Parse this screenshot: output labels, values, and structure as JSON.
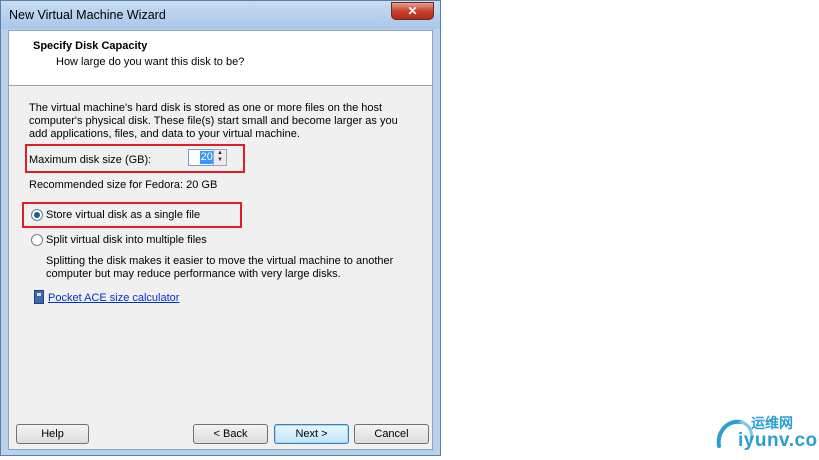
{
  "window": {
    "title": "New Virtual Machine Wizard",
    "close_glyph": "✕"
  },
  "header": {
    "title": "Specify Disk Capacity",
    "subtitle": "How large do you want this disk to be?"
  },
  "body": {
    "description_lines": [
      "The virtual machine's hard disk is stored as one or more files on the host",
      "computer's physical disk. These file(s) start small and become larger as you",
      "add applications, files, and data to your virtual machine."
    ],
    "max_disk_label": "Maximum disk size (GB):",
    "max_disk_value": "20.0",
    "recommended": "Recommended size for Fedora: 20 GB",
    "option_single": "Store virtual disk as a single file",
    "option_single_selected": true,
    "option_multiple": "Split virtual disk into multiple files",
    "option_multiple_selected": false,
    "split_note_lines": [
      "Splitting the disk makes it easier to move the virtual machine to another",
      "computer but may reduce performance with very large disks."
    ],
    "calculator_link": "Pocket ACE size calculator"
  },
  "buttons": {
    "help": "Help",
    "back": "< Back",
    "next": "Next >",
    "cancel": "Cancel"
  },
  "watermark": {
    "cn": "运维网",
    "en": "iyunv.com"
  },
  "colors": {
    "highlight_box": "#e11d2a",
    "link": "#0033cc",
    "selection": "#3399ff",
    "watermark": "#2a9fd6"
  }
}
